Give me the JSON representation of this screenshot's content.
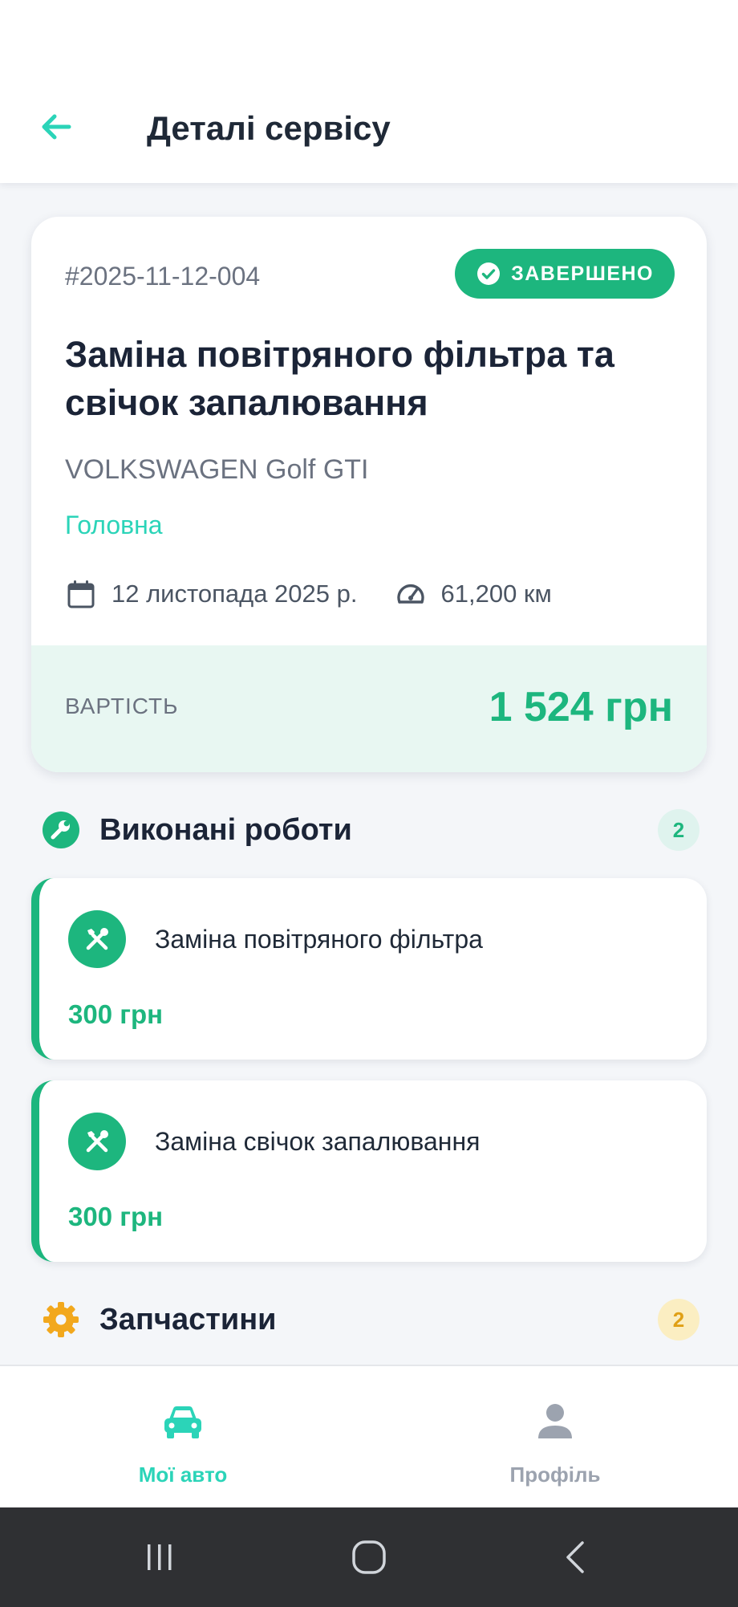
{
  "header": {
    "title": "Деталі сервісу",
    "back_icon": "arrow-left-icon"
  },
  "summary": {
    "order_id": "#2025-11-12-004",
    "status": "ЗАВЕРШЕНО",
    "title": "Заміна повітряного фільтра та свічок запалювання",
    "car": "VOLKSWAGEN Golf GTI",
    "category": "Головна",
    "date": "12 листопада 2025 р.",
    "mileage": "61,200 км",
    "cost_label": "ВАРТІСТЬ",
    "cost_value": "1 524 грн"
  },
  "works": {
    "title": "Виконані роботи",
    "count": "2",
    "items": [
      {
        "name": "Заміна повітряного фільтра",
        "price": "300 грн"
      },
      {
        "name": "Заміна свічок запалювання",
        "price": "300 грн"
      }
    ]
  },
  "parts": {
    "title": "Запчастини",
    "count": "2"
  },
  "bottom_nav": {
    "items": [
      {
        "label": "Мої авто",
        "icon": "car-icon",
        "active": true
      },
      {
        "label": "Профіль",
        "icon": "person-icon",
        "active": false
      }
    ]
  },
  "colors": {
    "primary": "#1db67e",
    "accent": "#2bd4b8",
    "text_dark": "#1b2437",
    "parts_accent": "#f2a81d"
  }
}
